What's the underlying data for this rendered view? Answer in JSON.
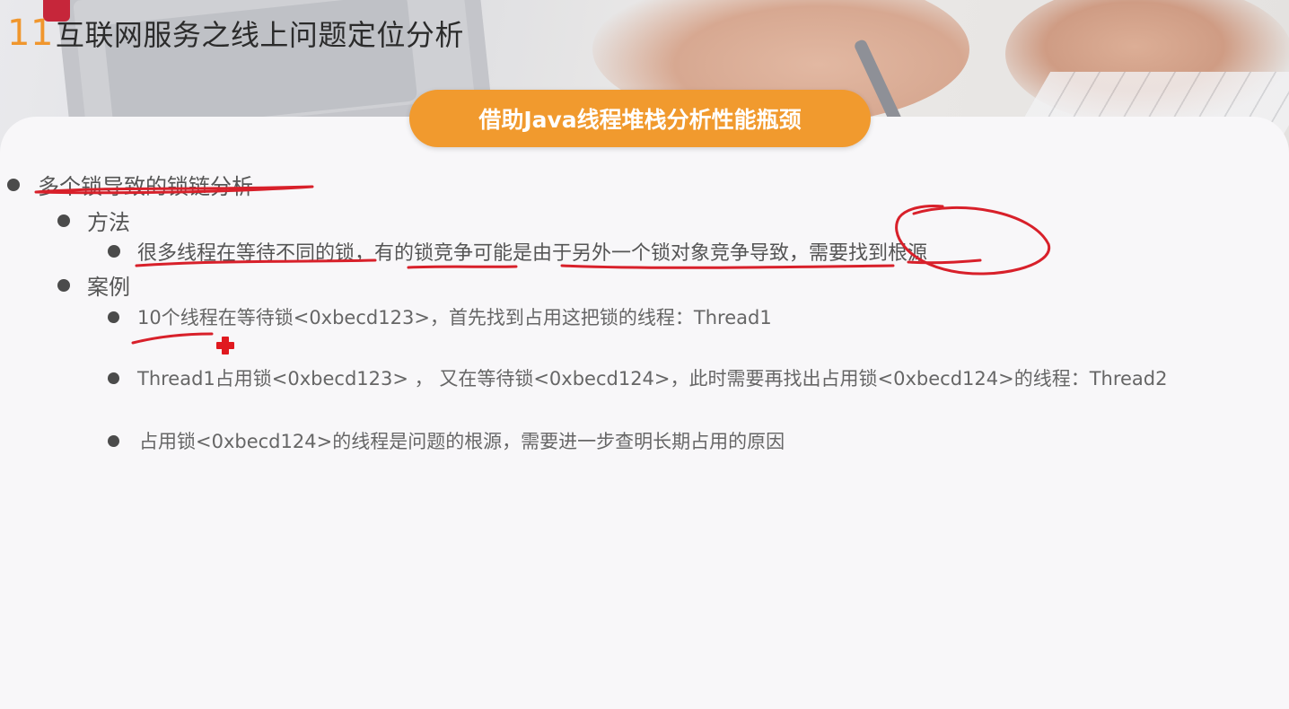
{
  "header": {
    "number": "11",
    "title": "互联网服务之线上问题定位分析"
  },
  "subtitle": "借助Java线程堆栈分析性能瓶颈",
  "outline": {
    "item1": "多个锁导致的锁链分析",
    "method_heading": "方法",
    "method_item": "很多线程在等待不同的锁，有的锁竞争可能是由于另外一个锁对象竞争导致，需要找到根源",
    "case_heading": "案例",
    "case_items": [
      "10个线程在等待锁<0xbecd123>，首先找到占用这把锁的线程：Thread1",
      "Thread1占用锁<0xbecd123> ， 又在等待锁<0xbecd124>，此时需要再找出占用锁<0xbecd124>的线程：Thread2",
      "占用锁<0xbecd124>的线程是问题的根源，需要进一步查明长期占用的原因"
    ]
  },
  "colors": {
    "accent": "#f19a2e",
    "annotation_ink": "#d8202a",
    "bullet": "#4b4b4b",
    "text": "#555555"
  },
  "icons": {
    "cursor": "red-cross-pointer-icon"
  }
}
